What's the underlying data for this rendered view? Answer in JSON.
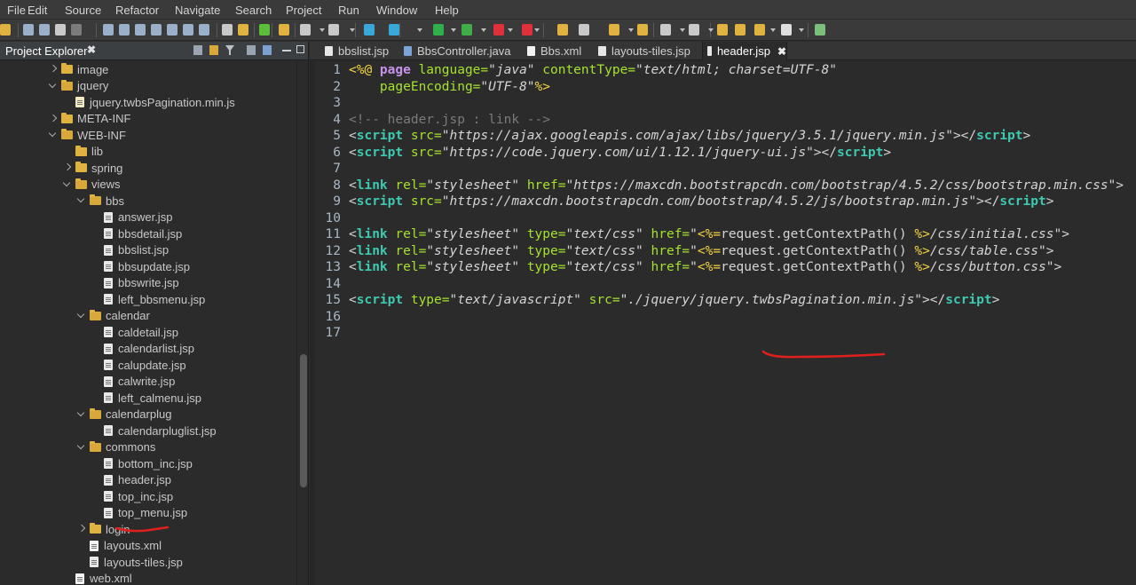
{
  "menubar": {
    "items": [
      "File",
      "Edit",
      "Source",
      "Refactor",
      "Navigate",
      "Search",
      "Project",
      "Run",
      "Window",
      "Help"
    ]
  },
  "explorer": {
    "title": "Project Explorer",
    "close_label": "✖",
    "tree": [
      {
        "label": "image",
        "type": "folder",
        "state": "collapsed",
        "indent": 1
      },
      {
        "label": "jquery",
        "type": "folder",
        "state": "expanded",
        "indent": 1
      },
      {
        "label": "jquery.twbsPagination.min.js",
        "type": "file-js",
        "state": "none",
        "indent": 2
      },
      {
        "label": "META-INF",
        "type": "folder",
        "state": "collapsed",
        "indent": 1
      },
      {
        "label": "WEB-INF",
        "type": "folder",
        "state": "expanded",
        "indent": 1
      },
      {
        "label": "lib",
        "type": "folder",
        "state": "none",
        "indent": 2
      },
      {
        "label": "spring",
        "type": "folder",
        "state": "collapsed",
        "indent": 2
      },
      {
        "label": "views",
        "type": "folder",
        "state": "expanded",
        "indent": 2
      },
      {
        "label": "bbs",
        "type": "folder",
        "state": "expanded",
        "indent": 3
      },
      {
        "label": "answer.jsp",
        "type": "file",
        "state": "none",
        "indent": 4
      },
      {
        "label": "bbsdetail.jsp",
        "type": "file",
        "state": "none",
        "indent": 4
      },
      {
        "label": "bbslist.jsp",
        "type": "file",
        "state": "none",
        "indent": 4
      },
      {
        "label": "bbsupdate.jsp",
        "type": "file",
        "state": "none",
        "indent": 4
      },
      {
        "label": "bbswrite.jsp",
        "type": "file",
        "state": "none",
        "indent": 4
      },
      {
        "label": "left_bbsmenu.jsp",
        "type": "file",
        "state": "none",
        "indent": 4
      },
      {
        "label": "calendar",
        "type": "folder",
        "state": "expanded",
        "indent": 3
      },
      {
        "label": "caldetail.jsp",
        "type": "file",
        "state": "none",
        "indent": 4
      },
      {
        "label": "calendarlist.jsp",
        "type": "file",
        "state": "none",
        "indent": 4
      },
      {
        "label": "calupdate.jsp",
        "type": "file",
        "state": "none",
        "indent": 4
      },
      {
        "label": "calwrite.jsp",
        "type": "file",
        "state": "none",
        "indent": 4
      },
      {
        "label": "left_calmenu.jsp",
        "type": "file",
        "state": "none",
        "indent": 4
      },
      {
        "label": "calendarplug",
        "type": "folder",
        "state": "expanded",
        "indent": 3
      },
      {
        "label": "calendarpluglist.jsp",
        "type": "file",
        "state": "none",
        "indent": 4
      },
      {
        "label": "commons",
        "type": "folder",
        "state": "expanded",
        "indent": 3
      },
      {
        "label": "bottom_inc.jsp",
        "type": "file",
        "state": "none",
        "indent": 4
      },
      {
        "label": "header.jsp",
        "type": "file",
        "state": "none",
        "indent": 4
      },
      {
        "label": "top_inc.jsp",
        "type": "file",
        "state": "none",
        "indent": 4
      },
      {
        "label": "top_menu.jsp",
        "type": "file",
        "state": "none",
        "indent": 4
      },
      {
        "label": "login",
        "type": "folder",
        "state": "collapsed",
        "indent": 3
      },
      {
        "label": "layouts.xml",
        "type": "file-xml",
        "state": "none",
        "indent": 3
      },
      {
        "label": "layouts-tiles.jsp",
        "type": "file",
        "state": "none",
        "indent": 3
      },
      {
        "label": "web.xml",
        "type": "file-xml",
        "state": "none",
        "indent": 2
      }
    ]
  },
  "editor": {
    "tabs": [
      {
        "label": "bbslist.jsp",
        "icon": "jsp-file-icon",
        "active": false
      },
      {
        "label": "BbsController.java",
        "icon": "java-file-icon",
        "active": false
      },
      {
        "label": "Bbs.xml",
        "icon": "xml-file-icon",
        "active": false
      },
      {
        "label": "layouts-tiles.jsp",
        "icon": "jsp-file-icon",
        "active": false
      },
      {
        "label": "header.jsp",
        "icon": "jsp-file-icon",
        "active": true
      }
    ],
    "active_tab_close": "✖",
    "lines": [
      {
        "n": "1",
        "tokens": [
          [
            "jsp",
            "<%@ "
          ],
          [
            "directive",
            "page "
          ],
          [
            "attr",
            "language="
          ],
          [
            "str",
            "\"java\" "
          ],
          [
            "attr",
            "contentType="
          ],
          [
            "str",
            "\"text/html; charset=UTF-8\""
          ]
        ]
      },
      {
        "n": "2",
        "tokens": [
          [
            "plain",
            "    "
          ],
          [
            "attr",
            "pageEncoding="
          ],
          [
            "str",
            "\"UTF-8\""
          ],
          [
            "jsp",
            "%>"
          ]
        ]
      },
      {
        "n": "3",
        "tokens": []
      },
      {
        "n": "4",
        "tokens": [
          [
            "comment",
            "<!-- header.jsp : link -->"
          ]
        ]
      },
      {
        "n": "5",
        "tokens": [
          [
            "plain",
            "<"
          ],
          [
            "tag",
            "script "
          ],
          [
            "attr",
            "src="
          ],
          [
            "str",
            "\"https://ajax.googleapis.com/ajax/libs/jquery/3.5.1/jquery.min.js\""
          ],
          [
            "plain",
            "></"
          ],
          [
            "tag",
            "script"
          ],
          [
            "plain",
            ">"
          ]
        ]
      },
      {
        "n": "6",
        "tokens": [
          [
            "plain",
            "<"
          ],
          [
            "tag",
            "script "
          ],
          [
            "attr",
            "src="
          ],
          [
            "str",
            "\"https://code.jquery.com/ui/1.12.1/jquery-ui.js\""
          ],
          [
            "plain",
            "></"
          ],
          [
            "tag",
            "script"
          ],
          [
            "plain",
            ">"
          ]
        ]
      },
      {
        "n": "7",
        "tokens": []
      },
      {
        "n": "8",
        "tokens": [
          [
            "plain",
            "<"
          ],
          [
            "tag",
            "link "
          ],
          [
            "attr",
            "rel="
          ],
          [
            "str",
            "\"stylesheet\" "
          ],
          [
            "attr",
            "href="
          ],
          [
            "str",
            "\"https://maxcdn.bootstrapcdn.com/bootstrap/4.5.2/css/bootstrap.min.css\""
          ],
          [
            "plain",
            ">"
          ]
        ]
      },
      {
        "n": "9",
        "tokens": [
          [
            "plain",
            "<"
          ],
          [
            "tag",
            "script "
          ],
          [
            "attr",
            "src="
          ],
          [
            "str",
            "\"https://maxcdn.bootstrapcdn.com/bootstrap/4.5.2/js/bootstrap.min.js\""
          ],
          [
            "plain",
            "></"
          ],
          [
            "tag",
            "script"
          ],
          [
            "plain",
            ">"
          ]
        ]
      },
      {
        "n": "10",
        "tokens": []
      },
      {
        "n": "11",
        "tokens": [
          [
            "plain",
            "<"
          ],
          [
            "tag",
            "link "
          ],
          [
            "attr",
            "rel="
          ],
          [
            "str",
            "\"stylesheet\" "
          ],
          [
            "attr",
            "type="
          ],
          [
            "str",
            "\"text/css\" "
          ],
          [
            "attr",
            "href="
          ],
          [
            "str",
            "\""
          ],
          [
            "jsp",
            "<%="
          ],
          [
            "plain",
            "request.getContextPath() "
          ],
          [
            "jsp",
            "%>"
          ],
          [
            "str",
            "/css/initial.css\""
          ],
          [
            "plain",
            ">"
          ]
        ]
      },
      {
        "n": "12",
        "tokens": [
          [
            "plain",
            "<"
          ],
          [
            "tag",
            "link "
          ],
          [
            "attr",
            "rel="
          ],
          [
            "str",
            "\"stylesheet\" "
          ],
          [
            "attr",
            "type="
          ],
          [
            "str",
            "\"text/css\" "
          ],
          [
            "attr",
            "href="
          ],
          [
            "str",
            "\""
          ],
          [
            "jsp",
            "<%="
          ],
          [
            "plain",
            "request.getContextPath() "
          ],
          [
            "jsp",
            "%>"
          ],
          [
            "str",
            "/css/table.css\""
          ],
          [
            "plain",
            ">"
          ]
        ]
      },
      {
        "n": "13",
        "tokens": [
          [
            "plain",
            "<"
          ],
          [
            "tag",
            "link "
          ],
          [
            "attr",
            "rel="
          ],
          [
            "str",
            "\"stylesheet\" "
          ],
          [
            "attr",
            "type="
          ],
          [
            "str",
            "\"text/css\" "
          ],
          [
            "attr",
            "href="
          ],
          [
            "str",
            "\""
          ],
          [
            "jsp",
            "<%="
          ],
          [
            "plain",
            "request.getContextPath() "
          ],
          [
            "jsp",
            "%>"
          ],
          [
            "str",
            "/css/button.css\""
          ],
          [
            "plain",
            ">"
          ]
        ]
      },
      {
        "n": "14",
        "tokens": []
      },
      {
        "n": "15",
        "tokens": [
          [
            "plain",
            "<"
          ],
          [
            "tag",
            "script "
          ],
          [
            "attr",
            "type="
          ],
          [
            "str",
            "\"text/javascript\" "
          ],
          [
            "attr",
            "src="
          ],
          [
            "str",
            "\"./jquery/jquery.twbsPagination.min.js\""
          ],
          [
            "plain",
            "></"
          ],
          [
            "tag",
            "script"
          ],
          [
            "plain",
            ">"
          ]
        ]
      },
      {
        "n": "16",
        "tokens": []
      },
      {
        "n": "17",
        "tokens": []
      }
    ]
  },
  "colors": {
    "annotation": "#e0201c",
    "tag": "#3ec9b0",
    "attr": "#a6e22e",
    "jsp_delim": "#f5d442"
  }
}
